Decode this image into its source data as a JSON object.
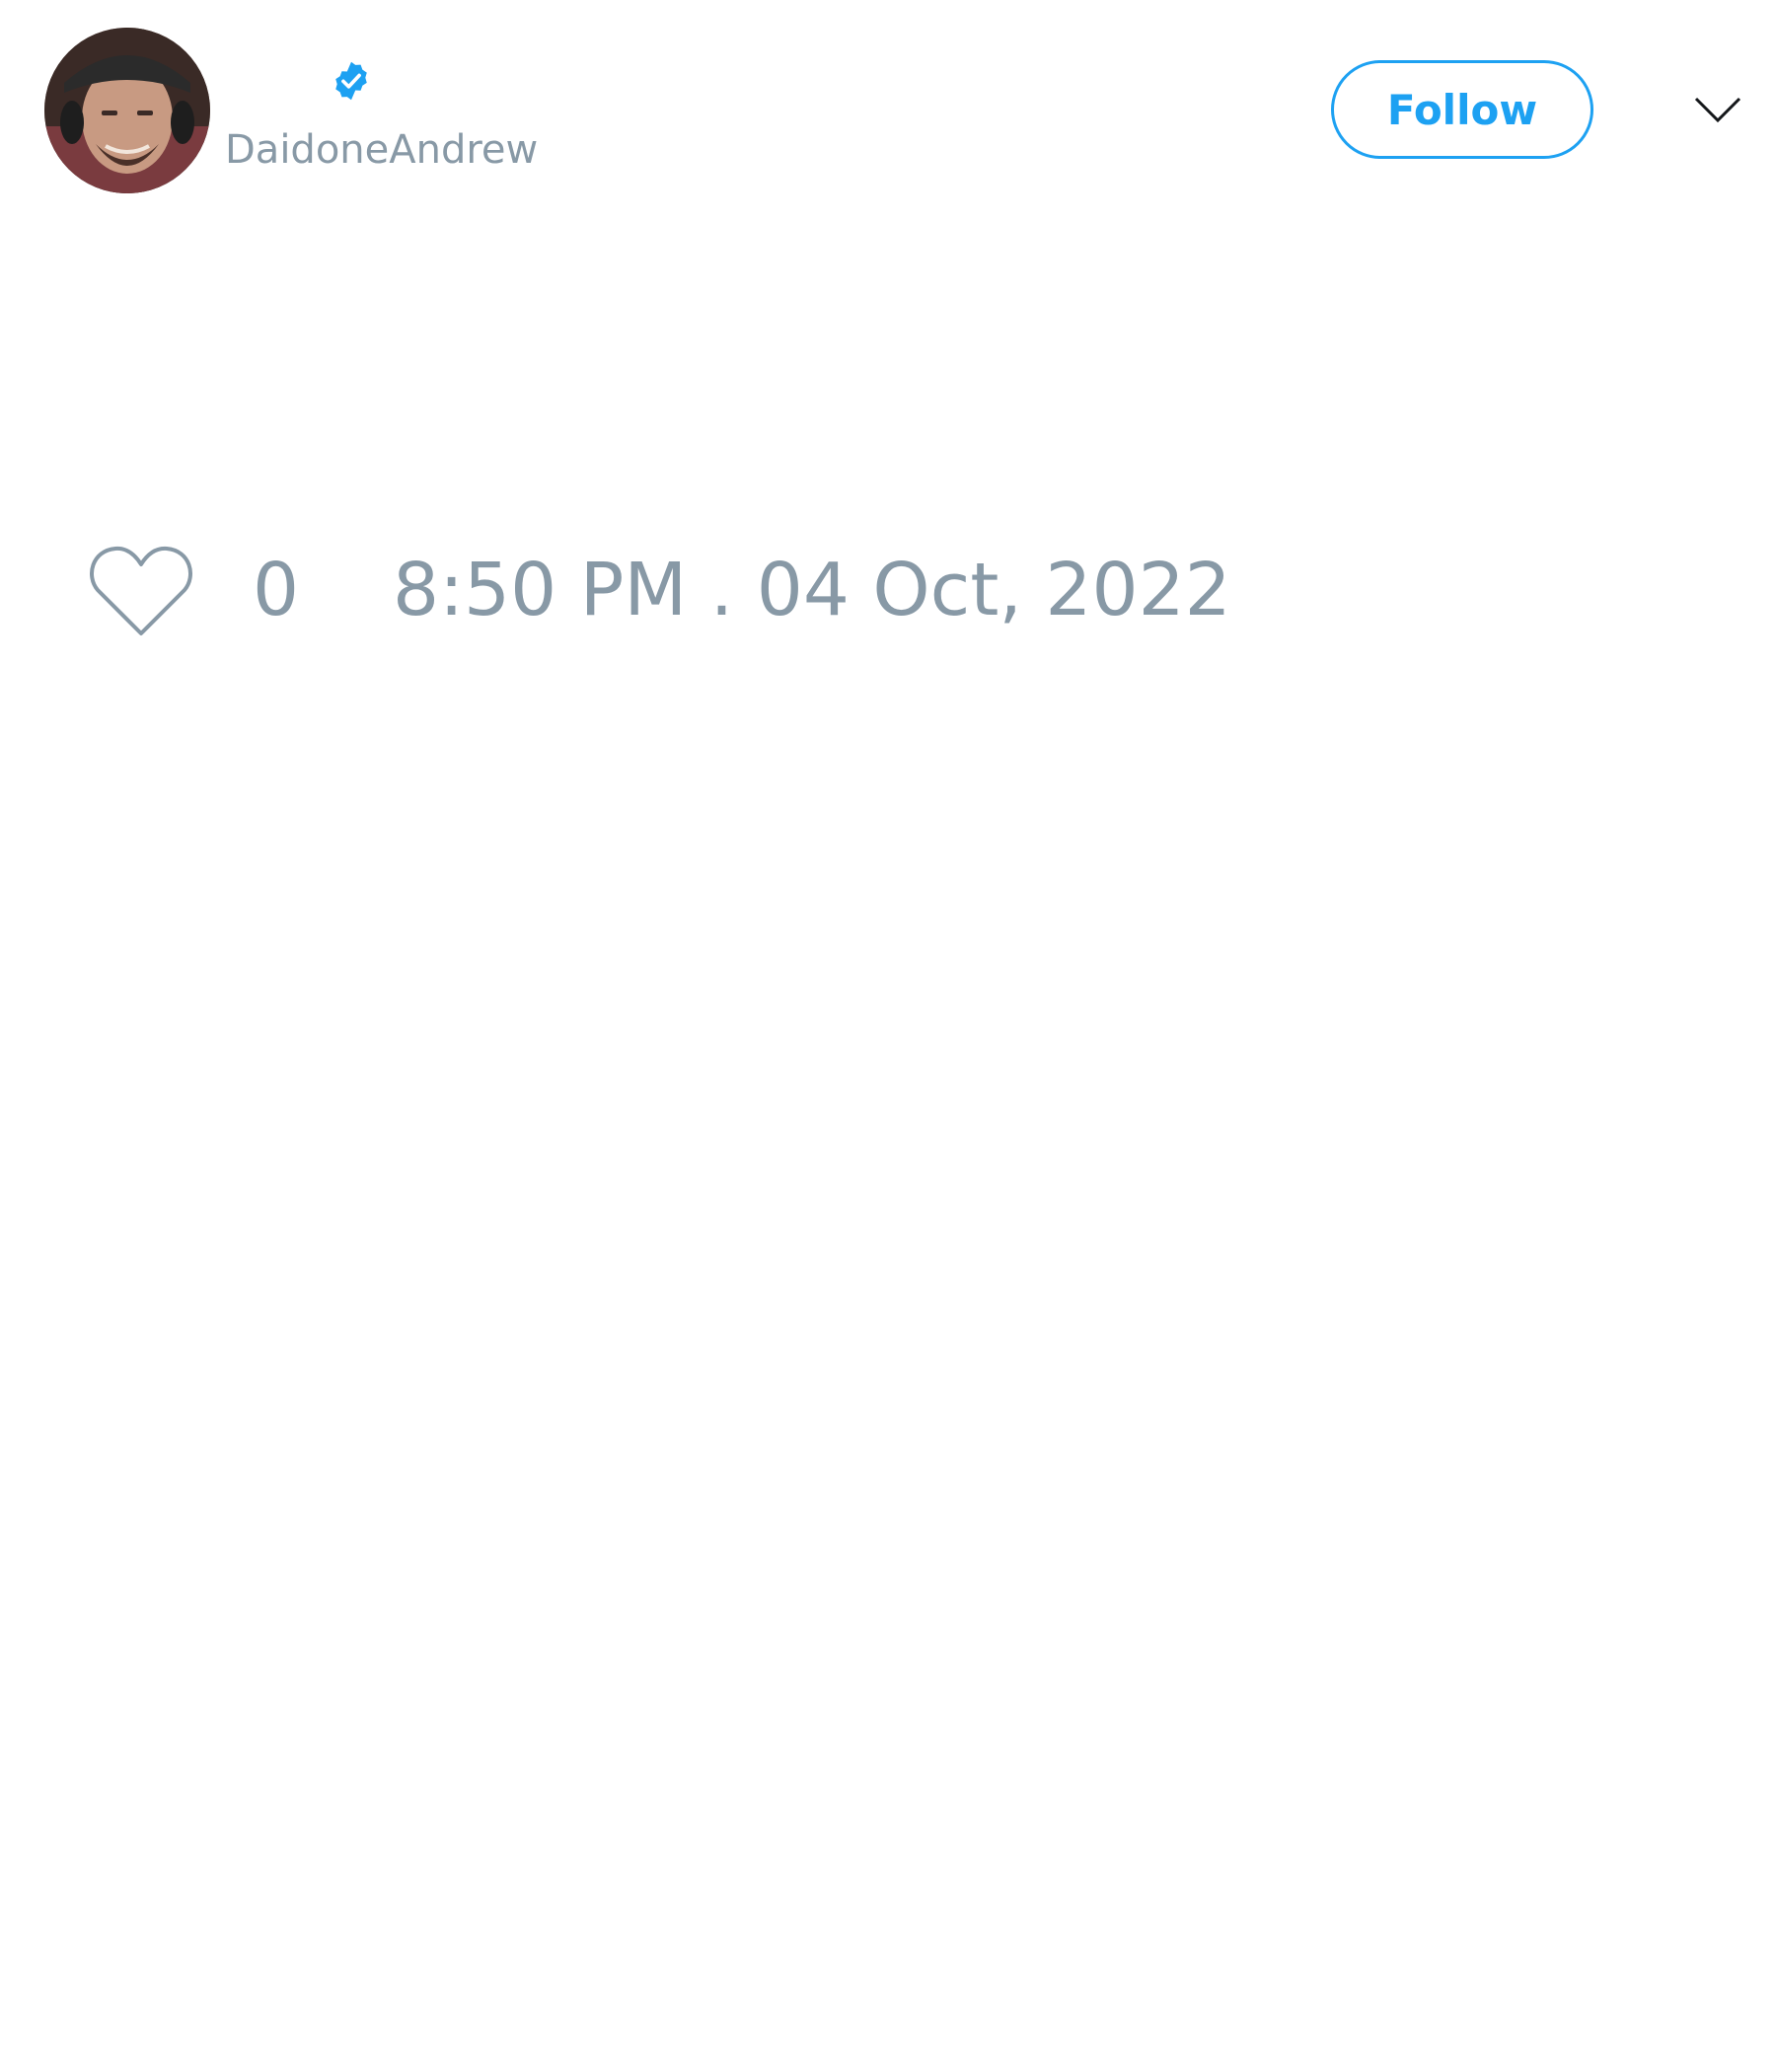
{
  "tweet": {
    "author": {
      "handle": "DaidoneAndrew",
      "verified": true,
      "avatar_icon": "user-avatar-photo"
    },
    "follow_button": {
      "label": "Follow"
    },
    "menu_icon": "chevron-down-icon",
    "actions": {
      "like_icon": "heart-outline-icon",
      "like_count": "0"
    },
    "timestamp": "8:50 PM . 04 Oct, 2022"
  },
  "colors": {
    "accent": "#1da1f2",
    "muted_text": "#8899a6",
    "background": "#ffffff"
  }
}
